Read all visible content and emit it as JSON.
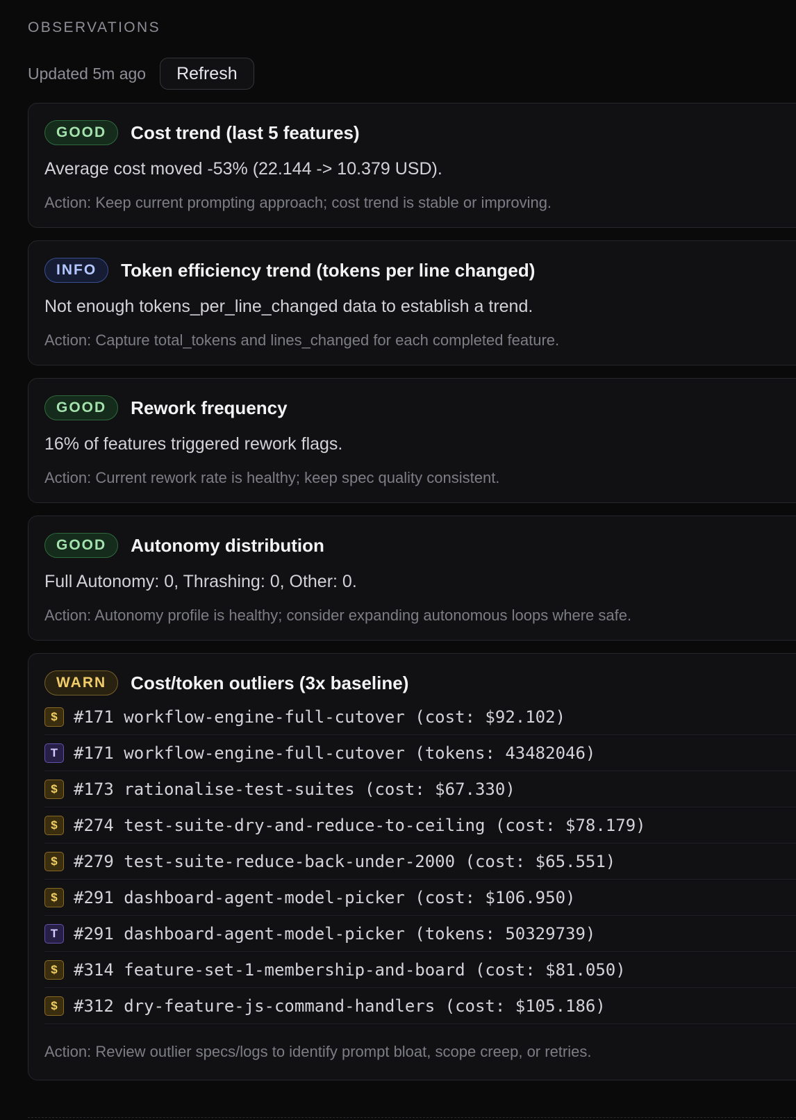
{
  "header": {
    "section_title": "OBSERVATIONS",
    "updated": "Updated 5m ago",
    "refresh_label": "Refresh"
  },
  "observations": [
    {
      "badge": "GOOD",
      "title": "Cost trend (last 5 features)",
      "text": "Average cost moved -53% (22.144 -> 10.379 USD).",
      "action": "Action: Keep current prompting approach; cost trend is stable or improving."
    },
    {
      "badge": "INFO",
      "title": "Token efficiency trend (tokens per line changed)",
      "text": "Not enough tokens_per_line_changed data to establish a trend.",
      "action": "Action: Capture total_tokens and lines_changed for each completed feature."
    },
    {
      "badge": "GOOD",
      "title": "Rework frequency",
      "text": "16% of features triggered rework flags.",
      "action": "Action: Current rework rate is healthy; keep spec quality consistent."
    },
    {
      "badge": "GOOD",
      "title": "Autonomy distribution",
      "text": "Full Autonomy: 0, Thrashing: 0, Other: 0.",
      "action": "Action: Autonomy profile is healthy; consider expanding autonomous loops where safe."
    }
  ],
  "outliers_card": {
    "badge": "WARN",
    "title": "Cost/token outliers (3x baseline)",
    "action": "Action: Review outlier specs/logs to identify prompt bloat, scope creep, or retries.",
    "rows": [
      {
        "kind": "$",
        "text": "#171 workflow-engine-full-cutover (cost: $92.102)"
      },
      {
        "kind": "T",
        "text": "#171 workflow-engine-full-cutover (tokens: 43482046)"
      },
      {
        "kind": "$",
        "text": "#173 rationalise-test-suites (cost: $67.330)"
      },
      {
        "kind": "$",
        "text": "#274 test-suite-dry-and-reduce-to-ceiling (cost: $78.179)"
      },
      {
        "kind": "$",
        "text": "#279 test-suite-reduce-back-under-2000 (cost: $65.551)"
      },
      {
        "kind": "$",
        "text": "#291 dashboard-agent-model-picker (cost: $106.950)"
      },
      {
        "kind": "T",
        "text": "#291 dashboard-agent-model-picker (tokens: 50329739)"
      },
      {
        "kind": "$",
        "text": "#314 feature-set-1-membership-and-board (cost: $81.050)"
      },
      {
        "kind": "$",
        "text": "#312 dry-feature-js-command-handlers (cost: $105.186)"
      }
    ]
  },
  "colors": {
    "background": "#0a0a0b",
    "card": "#111113",
    "good": "#a4e3ad",
    "info": "#b5c7ff",
    "warn": "#f0cd6a",
    "cost_icon": "#f3cf62",
    "token_icon": "#d5ccff"
  }
}
